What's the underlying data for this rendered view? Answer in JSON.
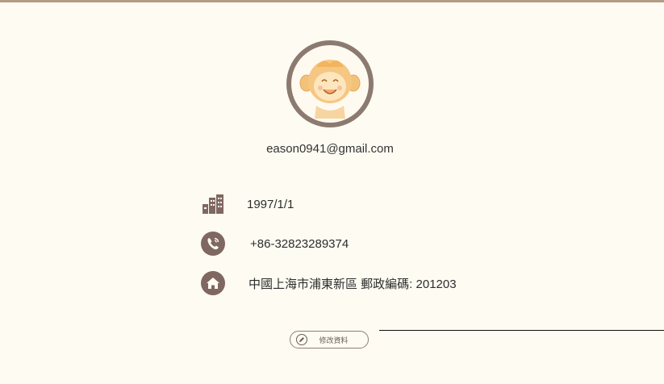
{
  "profile": {
    "email": "eason0941@gmail.com",
    "birthday": "1997/1/1",
    "phone": "+86-32823289374",
    "address": "中國上海市浦東新區 郵政編碼: 201203",
    "edit_label": "修改資料"
  },
  "icons": {
    "birthday": "building-icon",
    "phone": "phone-icon",
    "address": "home-icon",
    "edit": "pencil-icon"
  },
  "colors": {
    "background": "#fdfbf2",
    "icon_brown": "#7f6861",
    "accent_border": "#b49c86"
  }
}
